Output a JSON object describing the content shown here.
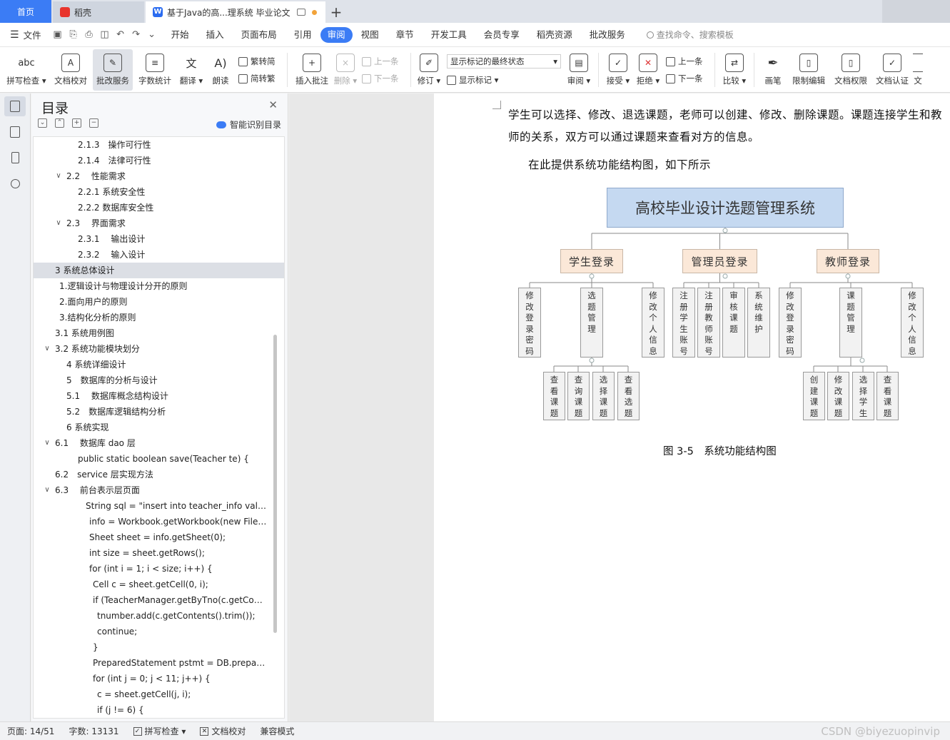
{
  "tabs": {
    "home": "首页",
    "daoke": "稻壳",
    "doc": "基于Java的高...理系统 毕业论文"
  },
  "menu": {
    "file": "文件",
    "items": [
      "开始",
      "插入",
      "页面布局",
      "引用",
      "审阅",
      "视图",
      "章节",
      "开发工具",
      "会员专享",
      "稻壳资源",
      "批改服务"
    ],
    "active": "审阅",
    "search": "查找命令、搜索模板"
  },
  "ribbon": {
    "spell": "拼写检查",
    "doccheck": "文档校对",
    "correct": "批改服务",
    "wordcount": "字数统计",
    "translate": "翻译",
    "read": "朗读",
    "t2s": "繁转简",
    "s2t": "简转繁",
    "insert_comment": "插入批注",
    "delete": "删除",
    "prev": "上一条",
    "next": "下一条",
    "revise": "修订",
    "markup_state": "显示标记的最终状态",
    "show_markup": "显示标记",
    "review": "审阅",
    "accept": "接受",
    "reject": "拒绝",
    "prev2": "上一条",
    "next2": "下一条",
    "compare": "比较",
    "pen": "画笔",
    "restrict": "限制编辑",
    "rights": "文档权限",
    "certify": "文档认证",
    "more": "文"
  },
  "toc": {
    "title": "目录",
    "ai": "智能识别目录",
    "items": [
      {
        "text": "2.1.3　操作可行性",
        "indent": 62,
        "chev": ""
      },
      {
        "text": "2.1.4　法律可行性",
        "indent": 62,
        "chev": ""
      },
      {
        "text": "2.2　 性能需求",
        "indent": 46,
        "chev": "v"
      },
      {
        "text": "2.2.1  系统安全性",
        "indent": 62,
        "chev": ""
      },
      {
        "text": "2.2.2  数据库安全性",
        "indent": 62,
        "chev": ""
      },
      {
        "text": "2.3　 界面需求",
        "indent": 46,
        "chev": "v"
      },
      {
        "text": "2.3.1　 输出设计",
        "indent": 62,
        "chev": ""
      },
      {
        "text": "2.3.2　 输入设计",
        "indent": 62,
        "chev": ""
      },
      {
        "text": "3  系统总体设计",
        "indent": 30,
        "chev": "",
        "selected": true
      },
      {
        "text": "1.逻辑设计与物理设计分开的原则",
        "indent": 36,
        "chev": ""
      },
      {
        "text": "2.面向用户的原则",
        "indent": 36,
        "chev": ""
      },
      {
        "text": "3.结构化分析的原则",
        "indent": 36,
        "chev": ""
      },
      {
        "text": "3.1  系统用例图",
        "indent": 30,
        "chev": ""
      },
      {
        "text": "3.2  系统功能模块划分",
        "indent": 30,
        "chev": "v"
      },
      {
        "text": "4  系统详细设计",
        "indent": 46,
        "chev": ""
      },
      {
        "text": "5　数据库的分析与设计",
        "indent": 46,
        "chev": ""
      },
      {
        "text": "5.1　 数据库概念结构设计",
        "indent": 46,
        "chev": ""
      },
      {
        "text": "5.2　数据库逻辑结构分析",
        "indent": 46,
        "chev": ""
      },
      {
        "text": "6  系统实现",
        "indent": 46,
        "chev": ""
      },
      {
        "text": "6.1　 数据库 dao 层",
        "indent": 30,
        "chev": "v"
      },
      {
        "text": "public static boolean save(Teacher te) {",
        "indent": 62,
        "chev": ""
      },
      {
        "text": "6.2　service 层实现方法",
        "indent": 30,
        "chev": ""
      },
      {
        "text": "6.3　 前台表示层页面",
        "indent": 30,
        "chev": "v"
      },
      {
        "text": "String sql = \"insert into teacher_info values(?,?,?,?,?,?,?,?,?,?,?)\";",
        "indent": 73,
        "chev": ""
      },
      {
        "text": "info = Workbook.getWorkbook(new File(filePath));",
        "indent": 78,
        "chev": ""
      },
      {
        "text": "Sheet sheet = info.getSheet(0);",
        "indent": 78,
        "chev": ""
      },
      {
        "text": "int size = sheet.getRows();",
        "indent": 78,
        "chev": ""
      },
      {
        "text": "for (int i = 1; i < size; i++) {",
        "indent": 78,
        "chev": ""
      },
      {
        "text": "Cell c = sheet.getCell(0, i);",
        "indent": 83,
        "chev": ""
      },
      {
        "text": "if (TeacherManager.getByTno(c.getContents().trim()) != null) {",
        "indent": 83,
        "chev": ""
      },
      {
        "text": "tnumber.add(c.getContents().trim());",
        "indent": 89,
        "chev": ""
      },
      {
        "text": "continue;",
        "indent": 89,
        "chev": ""
      },
      {
        "text": "}",
        "indent": 83,
        "chev": ""
      },
      {
        "text": "PreparedStatement pstmt = DB.prepareStatement(conn, sql);",
        "indent": 83,
        "chev": ""
      },
      {
        "text": "for (int j = 0; j < 11; j++) {",
        "indent": 83,
        "chev": ""
      },
      {
        "text": "c = sheet.getCell(j, i);",
        "indent": 89,
        "chev": ""
      },
      {
        "text": "if (j != 6) {",
        "indent": 89,
        "chev": ""
      }
    ]
  },
  "doc": {
    "para1": "学生可以选择、修改、退选课题，老师可以创建、修改、删除课题。课题连接学生和教",
    "para2": "师的关系，双方可以通过课题来查看对方的信息。",
    "para3": "在此提供系统功能结构图，如下所示",
    "caption": "图 3-5　系统功能结构图",
    "chart": {
      "root": "高校毕业设计选题管理系统",
      "mids": [
        "学生登录",
        "管理员登录",
        "教师登录"
      ],
      "leaves": [
        "修改登录密码",
        "选题管理",
        "修改个人信息",
        "注册学生账号",
        "注册教师账号",
        "审核课题",
        "系统维护",
        "修改登录密码",
        "课题管理",
        "修改个人信息"
      ],
      "subleaves": [
        "查看课题",
        "查询课题",
        "选择课题",
        "查看选题",
        "创建课题",
        "修改课题",
        "选择学生",
        "查看课题"
      ]
    }
  },
  "status": {
    "page": "页面: 14/51",
    "words": "字数: 13131",
    "spell": "拼写检查",
    "doccheck": "文档校对",
    "compat": "兼容模式",
    "watermark": "CSDN @biyezuopinvip"
  }
}
